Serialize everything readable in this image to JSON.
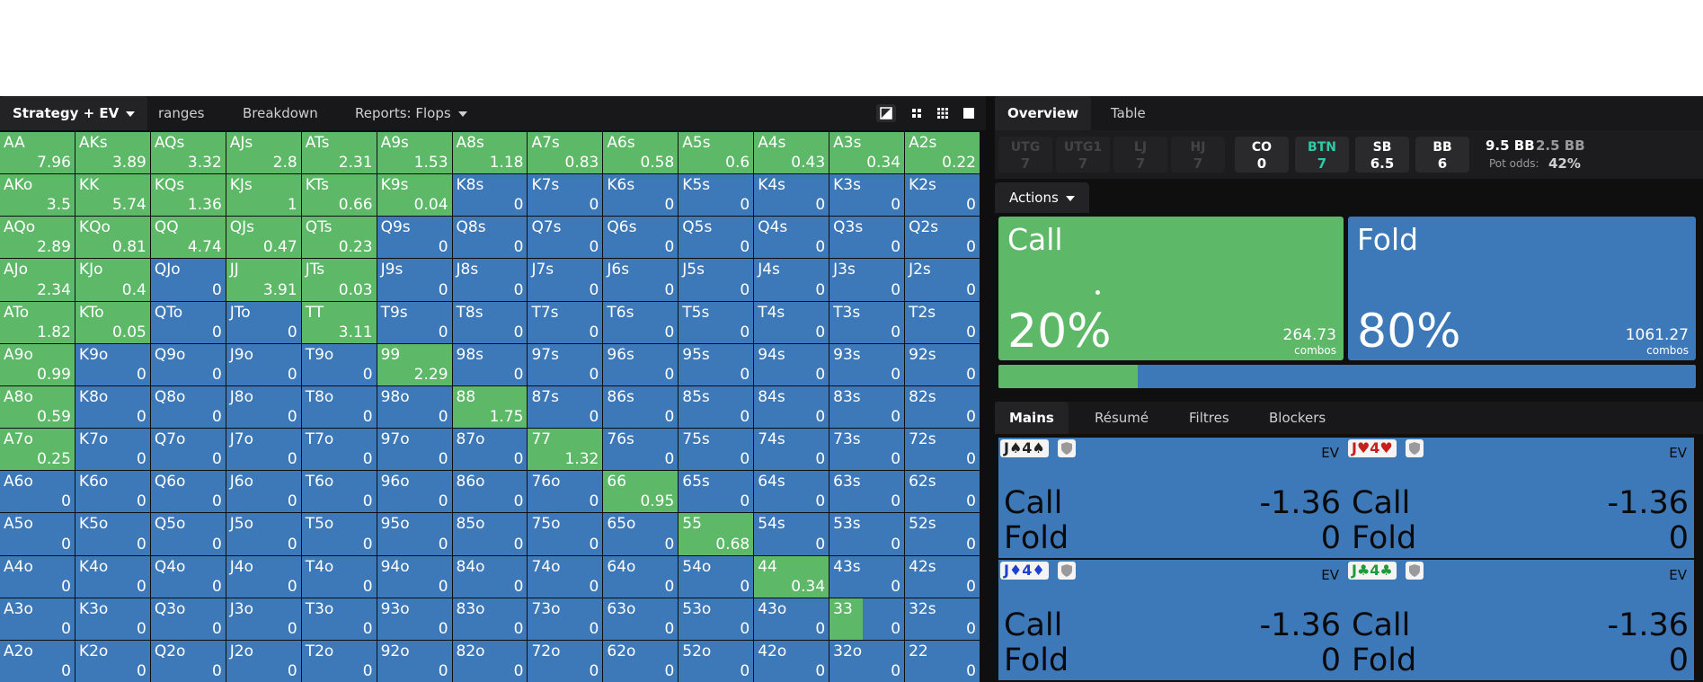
{
  "left_toolbar": {
    "tabs": [
      {
        "label": "Strategy + EV",
        "active": true,
        "dropdown": true
      },
      {
        "label": "ranges",
        "active": false,
        "dropdown": false
      },
      {
        "label": "Breakdown",
        "active": false,
        "dropdown": false
      },
      {
        "label": "Reports: Flops",
        "active": false,
        "dropdown": true
      }
    ],
    "view_icons": [
      "contrast-icon",
      "compact-view-icon",
      "grid-view-icon",
      "single-view-icon"
    ]
  },
  "colors": {
    "call": "#5db868",
    "fold": "#3d78b8",
    "background": "#0f0f10",
    "btn_accent": "#2ec9a6"
  },
  "grid": {
    "rows": [
      [
        {
          "hand": "AA",
          "call": 1,
          "ev": "7.96"
        },
        {
          "hand": "AKs",
          "call": 1,
          "ev": "3.89"
        },
        {
          "hand": "AQs",
          "call": 1,
          "ev": "3.32"
        },
        {
          "hand": "AJs",
          "call": 1,
          "ev": "2.8"
        },
        {
          "hand": "ATs",
          "call": 1,
          "ev": "2.31"
        },
        {
          "hand": "A9s",
          "call": 1,
          "ev": "1.53"
        },
        {
          "hand": "A8s",
          "call": 1,
          "ev": "1.18"
        },
        {
          "hand": "A7s",
          "call": 1,
          "ev": "0.83"
        },
        {
          "hand": "A6s",
          "call": 1,
          "ev": "0.58"
        },
        {
          "hand": "A5s",
          "call": 1,
          "ev": "0.6"
        },
        {
          "hand": "A4s",
          "call": 1,
          "ev": "0.43"
        },
        {
          "hand": "A3s",
          "call": 1,
          "ev": "0.34"
        },
        {
          "hand": "A2s",
          "call": 1,
          "ev": "0.22"
        }
      ],
      [
        {
          "hand": "AKo",
          "call": 1,
          "ev": "3.5"
        },
        {
          "hand": "KK",
          "call": 1,
          "ev": "5.74"
        },
        {
          "hand": "KQs",
          "call": 1,
          "ev": "1.36"
        },
        {
          "hand": "KJs",
          "call": 1,
          "ev": "1"
        },
        {
          "hand": "KTs",
          "call": 1,
          "ev": "0.66"
        },
        {
          "hand": "K9s",
          "call": 1,
          "ev": "0.04"
        },
        {
          "hand": "K8s",
          "call": 0,
          "ev": "0"
        },
        {
          "hand": "K7s",
          "call": 0,
          "ev": "0"
        },
        {
          "hand": "K6s",
          "call": 0,
          "ev": "0"
        },
        {
          "hand": "K5s",
          "call": 0,
          "ev": "0"
        },
        {
          "hand": "K4s",
          "call": 0,
          "ev": "0"
        },
        {
          "hand": "K3s",
          "call": 0,
          "ev": "0"
        },
        {
          "hand": "K2s",
          "call": 0,
          "ev": "0"
        }
      ],
      [
        {
          "hand": "AQo",
          "call": 1,
          "ev": "2.89"
        },
        {
          "hand": "KQo",
          "call": 1,
          "ev": "0.81"
        },
        {
          "hand": "QQ",
          "call": 1,
          "ev": "4.74"
        },
        {
          "hand": "QJs",
          "call": 1,
          "ev": "0.47"
        },
        {
          "hand": "QTs",
          "call": 1,
          "ev": "0.23"
        },
        {
          "hand": "Q9s",
          "call": 0,
          "ev": "0"
        },
        {
          "hand": "Q8s",
          "call": 0,
          "ev": "0"
        },
        {
          "hand": "Q7s",
          "call": 0,
          "ev": "0"
        },
        {
          "hand": "Q6s",
          "call": 0,
          "ev": "0"
        },
        {
          "hand": "Q5s",
          "call": 0,
          "ev": "0"
        },
        {
          "hand": "Q4s",
          "call": 0,
          "ev": "0"
        },
        {
          "hand": "Q3s",
          "call": 0,
          "ev": "0"
        },
        {
          "hand": "Q2s",
          "call": 0,
          "ev": "0"
        }
      ],
      [
        {
          "hand": "AJo",
          "call": 1,
          "ev": "2.34"
        },
        {
          "hand": "KJo",
          "call": 1,
          "ev": "0.4"
        },
        {
          "hand": "QJo",
          "call": 0,
          "ev": "0"
        },
        {
          "hand": "JJ",
          "call": 1,
          "ev": "3.91"
        },
        {
          "hand": "JTs",
          "call": 1,
          "ev": "0.03"
        },
        {
          "hand": "J9s",
          "call": 0,
          "ev": "0"
        },
        {
          "hand": "J8s",
          "call": 0,
          "ev": "0"
        },
        {
          "hand": "J7s",
          "call": 0,
          "ev": "0"
        },
        {
          "hand": "J6s",
          "call": 0,
          "ev": "0"
        },
        {
          "hand": "J5s",
          "call": 0,
          "ev": "0"
        },
        {
          "hand": "J4s",
          "call": 0,
          "ev": "0"
        },
        {
          "hand": "J3s",
          "call": 0,
          "ev": "0"
        },
        {
          "hand": "J2s",
          "call": 0,
          "ev": "0"
        }
      ],
      [
        {
          "hand": "ATo",
          "call": 1,
          "ev": "1.82"
        },
        {
          "hand": "KTo",
          "call": 1,
          "ev": "0.05"
        },
        {
          "hand": "QTo",
          "call": 0,
          "ev": "0"
        },
        {
          "hand": "JTo",
          "call": 0,
          "ev": "0"
        },
        {
          "hand": "TT",
          "call": 1,
          "ev": "3.11"
        },
        {
          "hand": "T9s",
          "call": 0,
          "ev": "0"
        },
        {
          "hand": "T8s",
          "call": 0,
          "ev": "0"
        },
        {
          "hand": "T7s",
          "call": 0,
          "ev": "0"
        },
        {
          "hand": "T6s",
          "call": 0,
          "ev": "0"
        },
        {
          "hand": "T5s",
          "call": 0,
          "ev": "0"
        },
        {
          "hand": "T4s",
          "call": 0,
          "ev": "0"
        },
        {
          "hand": "T3s",
          "call": 0,
          "ev": "0"
        },
        {
          "hand": "T2s",
          "call": 0,
          "ev": "0"
        }
      ],
      [
        {
          "hand": "A9o",
          "call": 1,
          "ev": "0.99"
        },
        {
          "hand": "K9o",
          "call": 0,
          "ev": "0"
        },
        {
          "hand": "Q9o",
          "call": 0,
          "ev": "0"
        },
        {
          "hand": "J9o",
          "call": 0,
          "ev": "0"
        },
        {
          "hand": "T9o",
          "call": 0,
          "ev": "0"
        },
        {
          "hand": "99",
          "call": 1,
          "ev": "2.29"
        },
        {
          "hand": "98s",
          "call": 0,
          "ev": "0"
        },
        {
          "hand": "97s",
          "call": 0,
          "ev": "0"
        },
        {
          "hand": "96s",
          "call": 0,
          "ev": "0"
        },
        {
          "hand": "95s",
          "call": 0,
          "ev": "0"
        },
        {
          "hand": "94s",
          "call": 0,
          "ev": "0"
        },
        {
          "hand": "93s",
          "call": 0,
          "ev": "0"
        },
        {
          "hand": "92s",
          "call": 0,
          "ev": "0"
        }
      ],
      [
        {
          "hand": "A8o",
          "call": 1,
          "ev": "0.59"
        },
        {
          "hand": "K8o",
          "call": 0,
          "ev": "0"
        },
        {
          "hand": "Q8o",
          "call": 0,
          "ev": "0"
        },
        {
          "hand": "J8o",
          "call": 0,
          "ev": "0"
        },
        {
          "hand": "T8o",
          "call": 0,
          "ev": "0"
        },
        {
          "hand": "98o",
          "call": 0,
          "ev": "0"
        },
        {
          "hand": "88",
          "call": 1,
          "ev": "1.75"
        },
        {
          "hand": "87s",
          "call": 0,
          "ev": "0"
        },
        {
          "hand": "86s",
          "call": 0,
          "ev": "0"
        },
        {
          "hand": "85s",
          "call": 0,
          "ev": "0"
        },
        {
          "hand": "84s",
          "call": 0,
          "ev": "0"
        },
        {
          "hand": "83s",
          "call": 0,
          "ev": "0"
        },
        {
          "hand": "82s",
          "call": 0,
          "ev": "0"
        }
      ],
      [
        {
          "hand": "A7o",
          "call": 1,
          "ev": "0.25"
        },
        {
          "hand": "K7o",
          "call": 0,
          "ev": "0"
        },
        {
          "hand": "Q7o",
          "call": 0,
          "ev": "0"
        },
        {
          "hand": "J7o",
          "call": 0,
          "ev": "0"
        },
        {
          "hand": "T7o",
          "call": 0,
          "ev": "0"
        },
        {
          "hand": "97o",
          "call": 0,
          "ev": "0"
        },
        {
          "hand": "87o",
          "call": 0,
          "ev": "0"
        },
        {
          "hand": "77",
          "call": 1,
          "ev": "1.32"
        },
        {
          "hand": "76s",
          "call": 0,
          "ev": "0"
        },
        {
          "hand": "75s",
          "call": 0,
          "ev": "0"
        },
        {
          "hand": "74s",
          "call": 0,
          "ev": "0"
        },
        {
          "hand": "73s",
          "call": 0,
          "ev": "0"
        },
        {
          "hand": "72s",
          "call": 0,
          "ev": "0"
        }
      ],
      [
        {
          "hand": "A6o",
          "call": 0,
          "ev": "0"
        },
        {
          "hand": "K6o",
          "call": 0,
          "ev": "0"
        },
        {
          "hand": "Q6o",
          "call": 0,
          "ev": "0"
        },
        {
          "hand": "J6o",
          "call": 0,
          "ev": "0"
        },
        {
          "hand": "T6o",
          "call": 0,
          "ev": "0"
        },
        {
          "hand": "96o",
          "call": 0,
          "ev": "0"
        },
        {
          "hand": "86o",
          "call": 0,
          "ev": "0"
        },
        {
          "hand": "76o",
          "call": 0,
          "ev": "0"
        },
        {
          "hand": "66",
          "call": 1,
          "ev": "0.95"
        },
        {
          "hand": "65s",
          "call": 0,
          "ev": "0"
        },
        {
          "hand": "64s",
          "call": 0,
          "ev": "0"
        },
        {
          "hand": "63s",
          "call": 0,
          "ev": "0"
        },
        {
          "hand": "62s",
          "call": 0,
          "ev": "0"
        }
      ],
      [
        {
          "hand": "A5o",
          "call": 0,
          "ev": "0"
        },
        {
          "hand": "K5o",
          "call": 0,
          "ev": "0"
        },
        {
          "hand": "Q5o",
          "call": 0,
          "ev": "0"
        },
        {
          "hand": "J5o",
          "call": 0,
          "ev": "0"
        },
        {
          "hand": "T5o",
          "call": 0,
          "ev": "0"
        },
        {
          "hand": "95o",
          "call": 0,
          "ev": "0"
        },
        {
          "hand": "85o",
          "call": 0,
          "ev": "0"
        },
        {
          "hand": "75o",
          "call": 0,
          "ev": "0"
        },
        {
          "hand": "65o",
          "call": 0,
          "ev": "0"
        },
        {
          "hand": "55",
          "call": 1,
          "ev": "0.68"
        },
        {
          "hand": "54s",
          "call": 0,
          "ev": "0"
        },
        {
          "hand": "53s",
          "call": 0,
          "ev": "0"
        },
        {
          "hand": "52s",
          "call": 0,
          "ev": "0"
        }
      ],
      [
        {
          "hand": "A4o",
          "call": 0,
          "ev": "0"
        },
        {
          "hand": "K4o",
          "call": 0,
          "ev": "0"
        },
        {
          "hand": "Q4o",
          "call": 0,
          "ev": "0"
        },
        {
          "hand": "J4o",
          "call": 0,
          "ev": "0"
        },
        {
          "hand": "T4o",
          "call": 0,
          "ev": "0"
        },
        {
          "hand": "94o",
          "call": 0,
          "ev": "0"
        },
        {
          "hand": "84o",
          "call": 0,
          "ev": "0"
        },
        {
          "hand": "74o",
          "call": 0,
          "ev": "0"
        },
        {
          "hand": "64o",
          "call": 0,
          "ev": "0"
        },
        {
          "hand": "54o",
          "call": 0,
          "ev": "0"
        },
        {
          "hand": "44",
          "call": 1,
          "ev": "0.34"
        },
        {
          "hand": "43s",
          "call": 0,
          "ev": "0"
        },
        {
          "hand": "42s",
          "call": 0,
          "ev": "0"
        }
      ],
      [
        {
          "hand": "A3o",
          "call": 0,
          "ev": "0"
        },
        {
          "hand": "K3o",
          "call": 0,
          "ev": "0"
        },
        {
          "hand": "Q3o",
          "call": 0,
          "ev": "0"
        },
        {
          "hand": "J3o",
          "call": 0,
          "ev": "0"
        },
        {
          "hand": "T3o",
          "call": 0,
          "ev": "0"
        },
        {
          "hand": "93o",
          "call": 0,
          "ev": "0"
        },
        {
          "hand": "83o",
          "call": 0,
          "ev": "0"
        },
        {
          "hand": "73o",
          "call": 0,
          "ev": "0"
        },
        {
          "hand": "63o",
          "call": 0,
          "ev": "0"
        },
        {
          "hand": "53o",
          "call": 0,
          "ev": "0"
        },
        {
          "hand": "43o",
          "call": 0,
          "ev": "0"
        },
        {
          "hand": "33",
          "call": 0.45,
          "ev": "0"
        },
        {
          "hand": "32s",
          "call": 0,
          "ev": "0"
        }
      ],
      [
        {
          "hand": "A2o",
          "call": 0,
          "ev": "0"
        },
        {
          "hand": "K2o",
          "call": 0,
          "ev": "0"
        },
        {
          "hand": "Q2o",
          "call": 0,
          "ev": "0"
        },
        {
          "hand": "J2o",
          "call": 0,
          "ev": "0"
        },
        {
          "hand": "T2o",
          "call": 0,
          "ev": "0"
        },
        {
          "hand": "92o",
          "call": 0,
          "ev": "0"
        },
        {
          "hand": "82o",
          "call": 0,
          "ev": "0"
        },
        {
          "hand": "72o",
          "call": 0,
          "ev": "0"
        },
        {
          "hand": "62o",
          "call": 0,
          "ev": "0"
        },
        {
          "hand": "52o",
          "call": 0,
          "ev": "0"
        },
        {
          "hand": "42o",
          "call": 0,
          "ev": "0"
        },
        {
          "hand": "32o",
          "call": 0,
          "ev": "0"
        },
        {
          "hand": "22",
          "call": 0,
          "ev": "0"
        }
      ]
    ]
  },
  "right": {
    "tabs": [
      {
        "label": "Overview",
        "active": true
      },
      {
        "label": "Table",
        "active": false
      }
    ],
    "positions": [
      {
        "name": "UTG",
        "stack": "7",
        "state": "dim"
      },
      {
        "name": "UTG1",
        "stack": "7",
        "state": "dim"
      },
      {
        "name": "LJ",
        "stack": "7",
        "state": "dim"
      },
      {
        "name": "HJ",
        "stack": "7",
        "state": "dim"
      },
      {
        "name": "CO",
        "stack": "0",
        "state": "on"
      },
      {
        "name": "BTN",
        "stack": "7",
        "state": "btn"
      },
      {
        "name": "SB",
        "stack": "6.5",
        "state": "on"
      },
      {
        "name": "BB",
        "stack": "6",
        "state": "on"
      }
    ],
    "pot": {
      "total": "9.5 BB",
      "to_call": "2.5 BB",
      "odds_label": "Pot odds:",
      "odds_value": "42%"
    },
    "actions_label": "Actions",
    "actions": [
      {
        "label": "Call",
        "percent": "20%",
        "combos": "264.73",
        "combos_label": "combos"
      },
      {
        "label": "Fold",
        "percent": "80%",
        "combos": "1061.27",
        "combos_label": "combos"
      }
    ],
    "call_fraction": 0.2,
    "hand_tabs": [
      {
        "label": "Mains",
        "active": true
      },
      {
        "label": "Résumé",
        "active": false
      },
      {
        "label": "Filtres",
        "active": false
      },
      {
        "label": "Blockers",
        "active": false
      }
    ],
    "hands": [
      {
        "combo": "J♠4♠",
        "color": "#222222",
        "ev_label": "EV",
        "call_label": "Call",
        "call_ev": "-1.36",
        "fold_label": "Fold",
        "fold_ev": "0"
      },
      {
        "combo": "J♥4♥",
        "color": "#c81e1e",
        "ev_label": "EV",
        "call_label": "Call",
        "call_ev": "-1.36",
        "fold_label": "Fold",
        "fold_ev": "0"
      },
      {
        "combo": "J♦4♦",
        "color": "#1e3fd2",
        "ev_label": "EV",
        "call_label": "Call",
        "call_ev": "-1.36",
        "fold_label": "Fold",
        "fold_ev": "0"
      },
      {
        "combo": "J♣4♣",
        "color": "#1d9a3a",
        "ev_label": "EV",
        "call_label": "Call",
        "call_ev": "-1.36",
        "fold_label": "Fold",
        "fold_ev": "0"
      }
    ]
  }
}
